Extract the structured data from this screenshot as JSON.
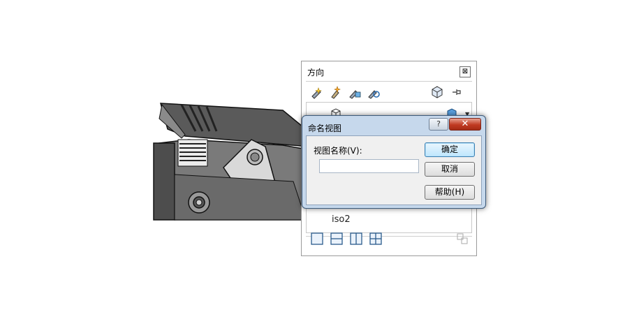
{
  "panel": {
    "title": "方向",
    "close_glyph": "⊠",
    "toolbar_icons": [
      "new-view-icon",
      "update-standard-views-icon",
      "reset-standard-views-icon",
      "view-selector-icon",
      "cube-view-icon",
      "pin-icon"
    ],
    "list_items": [
      {
        "label": "iso2"
      }
    ],
    "bottom_icons": [
      "single-view-icon",
      "two-view-horizontal-icon",
      "two-view-vertical-icon",
      "four-view-icon",
      "link-views-icon"
    ]
  },
  "dialog": {
    "title": "命名视图",
    "help_glyph": "?",
    "close_glyph": "✕",
    "field_label": "视图名称(V):",
    "field_value": "",
    "buttons": {
      "ok": "确定",
      "cancel": "取消",
      "help": "帮助(H)"
    }
  }
}
